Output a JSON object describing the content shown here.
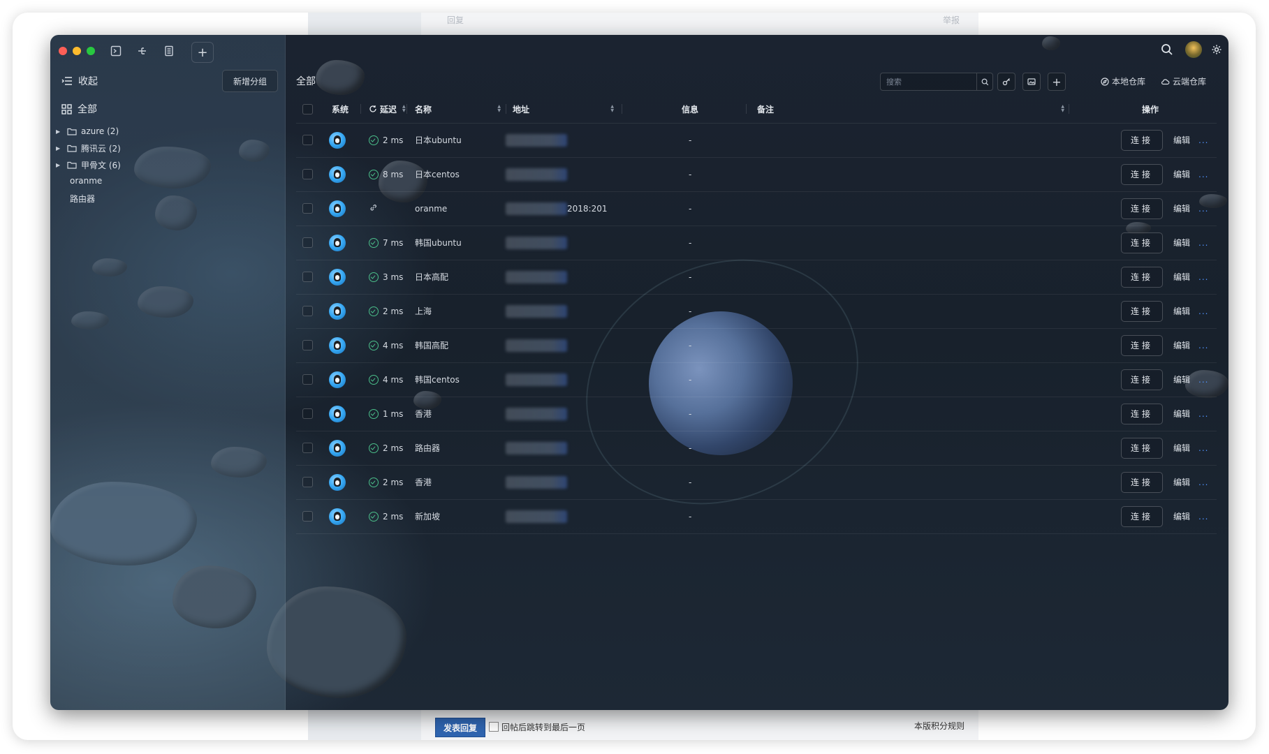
{
  "background": {
    "reply_text": "回复",
    "report_text": "举报",
    "post_reply_button": "发表回复",
    "jump_checkbox_label": "回帖后跳转到最后一页",
    "rules_link": "本版积分规则"
  },
  "app": {
    "sidebar": {
      "collapse_label": "收起",
      "new_group_button": "新增分组",
      "all_label": "全部",
      "tree": [
        {
          "label": "azure (2)",
          "expandable": true
        },
        {
          "label": "腾讯云 (2)",
          "expandable": true
        },
        {
          "label": "甲骨文 (6)",
          "expandable": true
        },
        {
          "label": "oranme",
          "expandable": false
        },
        {
          "label": "路由器",
          "expandable": false
        }
      ]
    },
    "header": {
      "title": "全部",
      "search_placeholder": "搜索",
      "local_repo_label": "本地仓库",
      "cloud_repo_label": "云端仓库"
    },
    "table": {
      "columns": {
        "system": "系统",
        "latency": "延迟",
        "name": "名称",
        "address": "地址",
        "info": "信息",
        "note": "备注",
        "actions": "操作"
      },
      "connect_label": "连接",
      "edit_label": "编辑",
      "more_label": "...",
      "rows": [
        {
          "latency": "2 ms",
          "name": "日本ubuntu",
          "address_suffix": "",
          "info": "-"
        },
        {
          "latency": "8 ms",
          "name": "日本centos",
          "address_suffix": "",
          "info": "-"
        },
        {
          "latency": "",
          "name": "oranme",
          "address_suffix": "2018:201",
          "info": "-"
        },
        {
          "latency": "7 ms",
          "name": "韩国ubuntu",
          "address_suffix": "",
          "info": "-"
        },
        {
          "latency": "3 ms",
          "name": "日本高配",
          "address_suffix": "",
          "info": "-"
        },
        {
          "latency": "2 ms",
          "name": "上海",
          "address_suffix": "",
          "info": "-"
        },
        {
          "latency": "4 ms",
          "name": "韩国高配",
          "address_suffix": "",
          "info": "-"
        },
        {
          "latency": "4 ms",
          "name": "韩国centos",
          "address_suffix": "",
          "info": "-"
        },
        {
          "latency": "1 ms",
          "name": "香港",
          "address_suffix": "",
          "info": "-"
        },
        {
          "latency": "2 ms",
          "name": "路由器",
          "address_suffix": "",
          "info": "-"
        },
        {
          "latency": "2 ms",
          "name": "香港",
          "address_suffix": "",
          "info": "-"
        },
        {
          "latency": "2 ms",
          "name": "新加坡",
          "address_suffix": "",
          "info": "-"
        }
      ]
    }
  }
}
